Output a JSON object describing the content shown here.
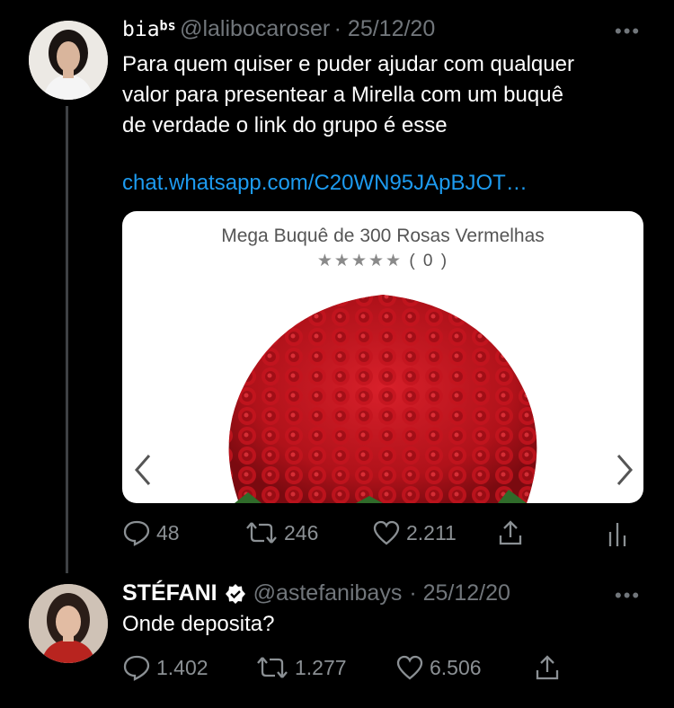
{
  "tweet1": {
    "author_name": "bia",
    "author_name_sup": "bs",
    "handle": "@lalibocaroser",
    "date": "· 25/12/20",
    "text_lines": [
      "Para quem quiser e puder ajudar com qualquer",
      "valor para presentear a Mirella com um buquê",
      "de verdade o link do grupo é esse"
    ],
    "link": "chat.whatsapp.com/C20WN95JApBJOT…",
    "card": {
      "title": "Mega Buquê de 300 Rosas Vermelhas",
      "stars": "★★★★★",
      "rating_count": "( 0 )"
    },
    "actions": {
      "replies": "48",
      "retweets": "246",
      "likes": "2.211"
    },
    "more": "•••"
  },
  "tweet2": {
    "author_name": "STÉFANI",
    "handle": "@astefanibays",
    "date": "· 25/12/20",
    "text": "Onde deposita?",
    "actions": {
      "replies": "1.402",
      "retweets": "1.277",
      "likes": "6.506"
    },
    "more": "•••"
  },
  "colors": {
    "background": "#000000",
    "link": "#1d9bf0",
    "muted": "#71767b",
    "verified": "#ffffff"
  },
  "icons": [
    "reply-icon",
    "retweet-icon",
    "like-icon",
    "share-icon",
    "analytics-icon",
    "verified-badge-icon",
    "more-icon",
    "chevron-left-icon",
    "chevron-right-icon"
  ]
}
